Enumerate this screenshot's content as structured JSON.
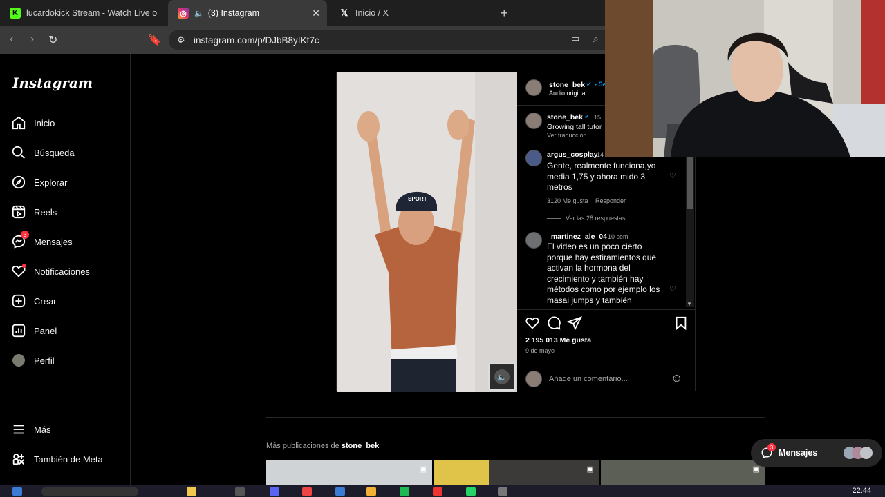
{
  "browser": {
    "tabs": [
      {
        "title": "lucardokick Stream - Watch Live on K",
        "icon": "kick-icon",
        "active": false
      },
      {
        "title": "(3) Instagram",
        "icon": "instagram-icon",
        "active": true
      },
      {
        "title": "Inicio / X",
        "icon": "x-icon",
        "active": false
      }
    ],
    "url": "instagram.com/p/DJbB8yIKf7c"
  },
  "sidebar": {
    "logo": "Instagram",
    "items": [
      {
        "label": "Inicio",
        "icon": "home-icon"
      },
      {
        "label": "Búsqueda",
        "icon": "search-icon"
      },
      {
        "label": "Explorar",
        "icon": "compass-icon"
      },
      {
        "label": "Reels",
        "icon": "reels-icon"
      },
      {
        "label": "Mensajes",
        "icon": "messenger-icon",
        "badge": "3"
      },
      {
        "label": "Notificaciones",
        "icon": "heart-icon"
      },
      {
        "label": "Crear",
        "icon": "plus-square-icon"
      },
      {
        "label": "Panel",
        "icon": "chart-icon"
      },
      {
        "label": "Perfil",
        "icon": "avatar-icon"
      }
    ],
    "bottom": [
      {
        "label": "Más",
        "icon": "menu-icon"
      },
      {
        "label": "También de Meta",
        "icon": "meta-grid-icon"
      }
    ]
  },
  "post": {
    "header": {
      "username": "stone_bek",
      "sub": "Audio original",
      "follow": "• Se"
    },
    "caption": {
      "username": "stone_bek",
      "time": "15",
      "text": "Growing tall tutor",
      "translate": "Ver traducción"
    },
    "comments": [
      {
        "username": "argus_cosplay",
        "time": "14",
        "text": "Gente, realmente funciona,yo media 1,75 y ahora mido 3 metros",
        "likes": "3120 Me gusta",
        "reply": "Responder",
        "replies": "Ver las 28 respuestas"
      },
      {
        "username": "_martinez_ale_04",
        "time": "10 sem",
        "text": "El video es un poco cierto porque hay estiramientos que activan la hormona del crecimiento y también hay métodos como por ejemplo los masai jumps y también"
      }
    ],
    "likes": "2 195 013 Me gusta",
    "date": "9 de mayo",
    "comment_placeholder": "Añade un comentario..."
  },
  "more": {
    "prefix": "Más publicaciones de",
    "user": "stone_bek"
  },
  "messages_pill": {
    "label": "Mensajes",
    "badge": "3"
  },
  "taskbar": {
    "clock": "22:44"
  },
  "colors": {
    "accent_badge": "#ff3040",
    "bg": "#000000",
    "border": "#262626"
  }
}
